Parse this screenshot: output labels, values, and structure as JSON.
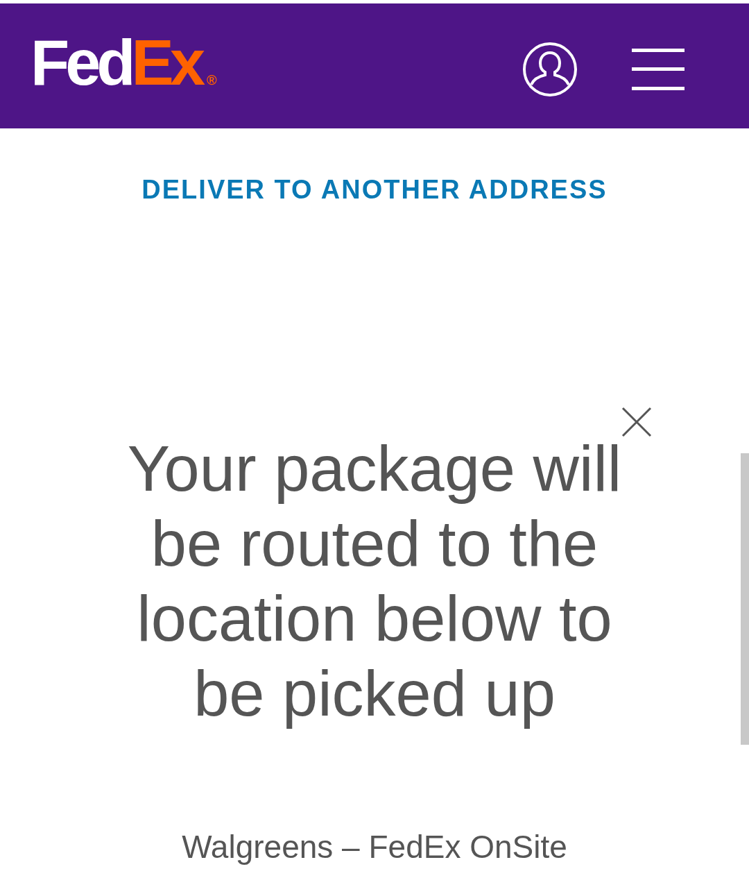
{
  "header": {
    "logo": {
      "part_1": "Fed",
      "part_2": "Ex",
      "mark": "®"
    }
  },
  "links": [
    "DELIVER TO ANOTHER ADDRESS"
  ],
  "message": "Your package will be routed to the location below to be picked up",
  "location": "Walgreens – FedEx OnSite"
}
